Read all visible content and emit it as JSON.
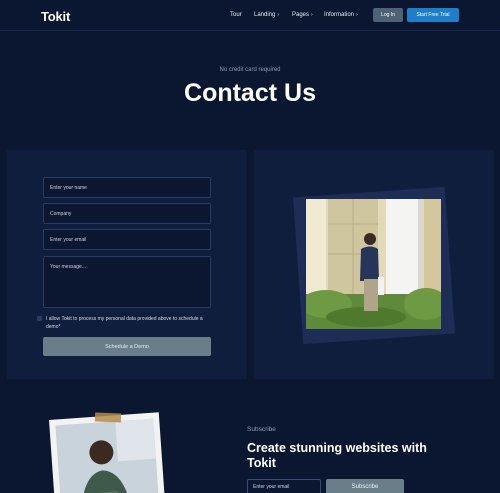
{
  "header": {
    "logo": "Tokit",
    "nav": [
      {
        "label": "Tour",
        "has_menu": false
      },
      {
        "label": "Landing",
        "has_menu": true
      },
      {
        "label": "Pages",
        "has_menu": true
      },
      {
        "label": "Information",
        "has_menu": true
      }
    ],
    "login_label": "Log In",
    "trial_label": "Start Free Trial"
  },
  "hero": {
    "eyebrow": "No credit card required",
    "title": "Contact Us"
  },
  "form": {
    "name_placeholder": "Enter your name",
    "company_placeholder": "Company",
    "email_placeholder": "Enter your email",
    "message_placeholder": "Your message...",
    "consent": "I allow Tokit to process my personal data provided above to schedule a demo*",
    "submit_label": "Schedule a Demo"
  },
  "subscribe": {
    "eyebrow": "Subscribe",
    "title": "Create stunning websites with Tokit",
    "email_placeholder": "Enter your email",
    "button_label": "Subscribe"
  },
  "colors": {
    "background": "#0b1731",
    "panel": "#0f1e3d",
    "primary_button": "#1d7fc9",
    "muted_button": "#6a7e8a"
  }
}
